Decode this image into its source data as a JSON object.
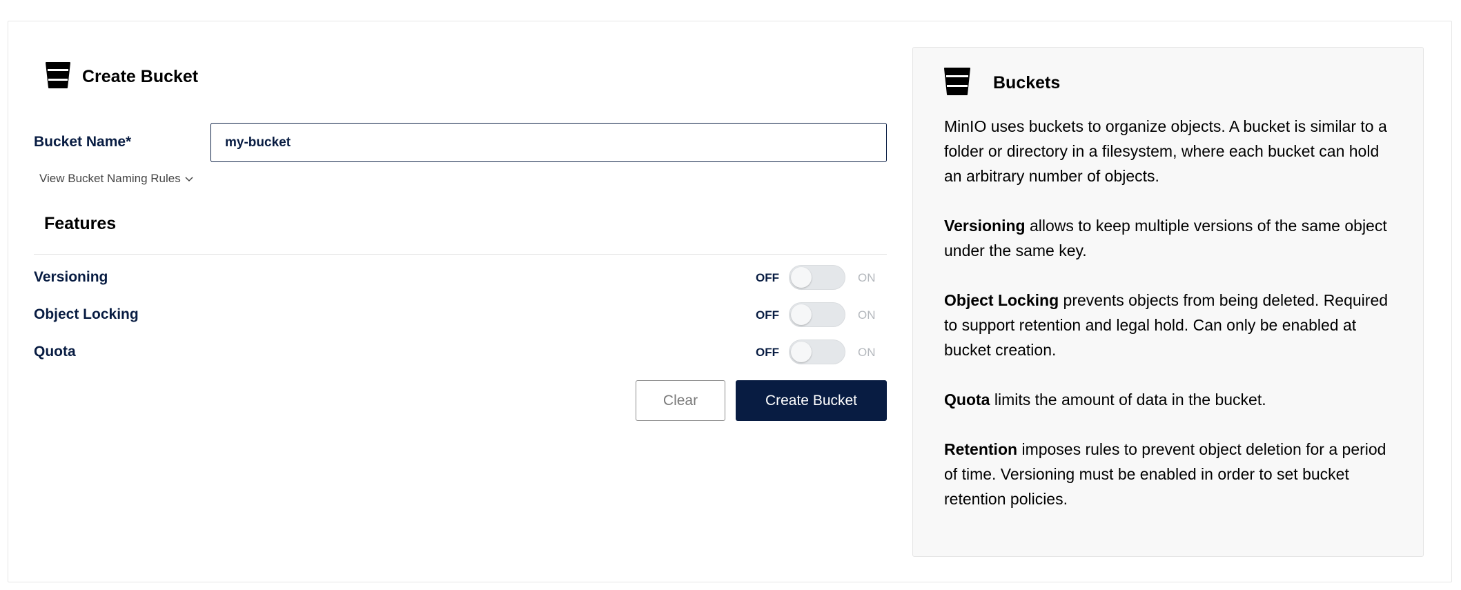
{
  "form": {
    "title": "Create Bucket",
    "bucket_name_label": "Bucket Name*",
    "bucket_name_value": "my-bucket",
    "naming_rules_link": "View Bucket Naming Rules",
    "features_title": "Features",
    "features": [
      {
        "label": "Versioning",
        "off_label": "OFF",
        "on_label": "ON",
        "enabled": false
      },
      {
        "label": "Object Locking",
        "off_label": "OFF",
        "on_label": "ON",
        "enabled": false
      },
      {
        "label": "Quota",
        "off_label": "OFF",
        "on_label": "ON",
        "enabled": false
      }
    ],
    "clear_button": "Clear",
    "create_button": "Create Bucket"
  },
  "help": {
    "title": "Buckets",
    "intro": "MinIO uses buckets to organize objects. A bucket is similar to a folder or directory in a filesystem, where each bucket can hold an arbitrary number of objects.",
    "items": [
      {
        "term": "Versioning",
        "text": " allows to keep multiple versions of the same object under the same key."
      },
      {
        "term": "Object Locking",
        "text": " prevents objects from being deleted. Required to support retention and legal hold. Can only be enabled at bucket creation."
      },
      {
        "term": "Quota",
        "text": " limits the amount of data in the bucket."
      },
      {
        "term": "Retention",
        "text": " imposes rules to prevent object deletion for a period of time. Versioning must be enabled in order to set bucket retention policies."
      }
    ]
  },
  "icons": {
    "bucket": "bucket-icon",
    "chevron": "chevron-down-icon"
  },
  "colors": {
    "primary": "#081c42",
    "panel_bg": "#f8f8f8",
    "toggle_off": "#e4e7ea"
  }
}
